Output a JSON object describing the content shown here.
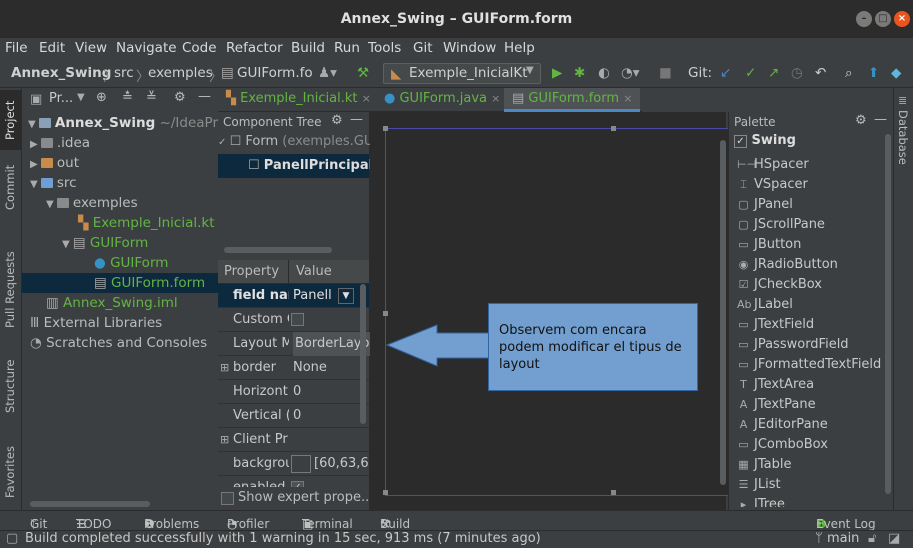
{
  "window": {
    "title": "Annex_Swing – GUIForm.form"
  },
  "menu": [
    "File",
    "Edit",
    "View",
    "Navigate",
    "Code",
    "Refactor",
    "Build",
    "Run",
    "Tools",
    "Git",
    "Window",
    "Help"
  ],
  "nav": {
    "crumbs": [
      "Annex_Swing",
      "src",
      "exemples",
      "GUIForm.fo"
    ],
    "run_config": "Exemple_InicialKt",
    "git_label": "Git:"
  },
  "sidebar_left": [
    "Project",
    "Commit",
    "Pull Requests",
    "Structure",
    "Favorites"
  ],
  "sidebar_right": [
    "Database"
  ],
  "project_panel": {
    "header": "Pr...",
    "tree": [
      {
        "label": "Annex_Swing",
        "extra": "~/IdeaProjec",
        "level": 0
      },
      {
        "label": ".idea",
        "level": 1
      },
      {
        "label": "out",
        "level": 1
      },
      {
        "label": "src",
        "level": 1
      },
      {
        "label": "exemples",
        "level": 2
      },
      {
        "label": "Exemple_Inicial.kt",
        "level": 3
      },
      {
        "label": "GUIForm",
        "level": 3
      },
      {
        "label": "GUIForm",
        "level": 4
      },
      {
        "label": "GUIForm.form",
        "level": 4
      },
      {
        "label": "Annex_Swing.iml",
        "level": 1
      },
      {
        "label": "External Libraries",
        "level": 0
      },
      {
        "label": "Scratches and Consoles",
        "level": 0
      }
    ]
  },
  "editor_tabs": [
    "Exemple_Inicial.kt",
    "GUIForm.java",
    "GUIForm.form"
  ],
  "component_tree": {
    "title": "Component Tree",
    "form_label": "Form",
    "form_extra": "(exemples.GU",
    "panel": "PanellPrincipal"
  },
  "properties": {
    "header_property": "Property",
    "header_value": "Value",
    "rows": [
      {
        "name": "field nam",
        "value": "Panell"
      },
      {
        "name": "Custom C",
        "value": ""
      },
      {
        "name": "Layout M",
        "value": "BorderLayout"
      },
      {
        "name": "border",
        "value": "None"
      },
      {
        "name": "Horizont",
        "value": "0"
      },
      {
        "name": "Vertical (",
        "value": "0"
      },
      {
        "name": "Client Pr",
        "value": ""
      },
      {
        "name": "backgrou",
        "value": "[60,63,6"
      },
      {
        "name": "enabled",
        "value": ""
      }
    ],
    "show_expert": "Show expert prope..."
  },
  "callout": {
    "text": "Observem com encara podem modificar el tipus de layout"
  },
  "palette": {
    "title": "Palette",
    "group": "Swing",
    "items": [
      "HSpacer",
      "VSpacer",
      "JPanel",
      "JScrollPane",
      "JButton",
      "JRadioButton",
      "JCheckBox",
      "JLabel",
      "JTextField",
      "JPasswordField",
      "JFormattedTextField",
      "JTextArea",
      "JTextPane",
      "JEditorPane",
      "JComboBox",
      "JTable",
      "JList",
      "JTree"
    ],
    "icons": [
      "⊢⊣",
      "⌶",
      "▢",
      "▢",
      "▭",
      "◉",
      "☑",
      "Ab",
      "▭",
      "▭",
      "▭",
      "T",
      "A",
      "A",
      "▭",
      "▦",
      "☰",
      "▸"
    ]
  },
  "bottom_tools": [
    "Git",
    "TODO",
    "Problems",
    "Profiler",
    "Terminal",
    "Build",
    "Event Log"
  ],
  "status": {
    "message": "Build completed successfully with 1 warning in 15 sec, 913 ms (7 minutes ago)",
    "branch": "main"
  },
  "colors": {
    "accent": "#4a88c7",
    "selection": "#0d293e",
    "green": "#62b543",
    "callout": "#729fcf"
  }
}
